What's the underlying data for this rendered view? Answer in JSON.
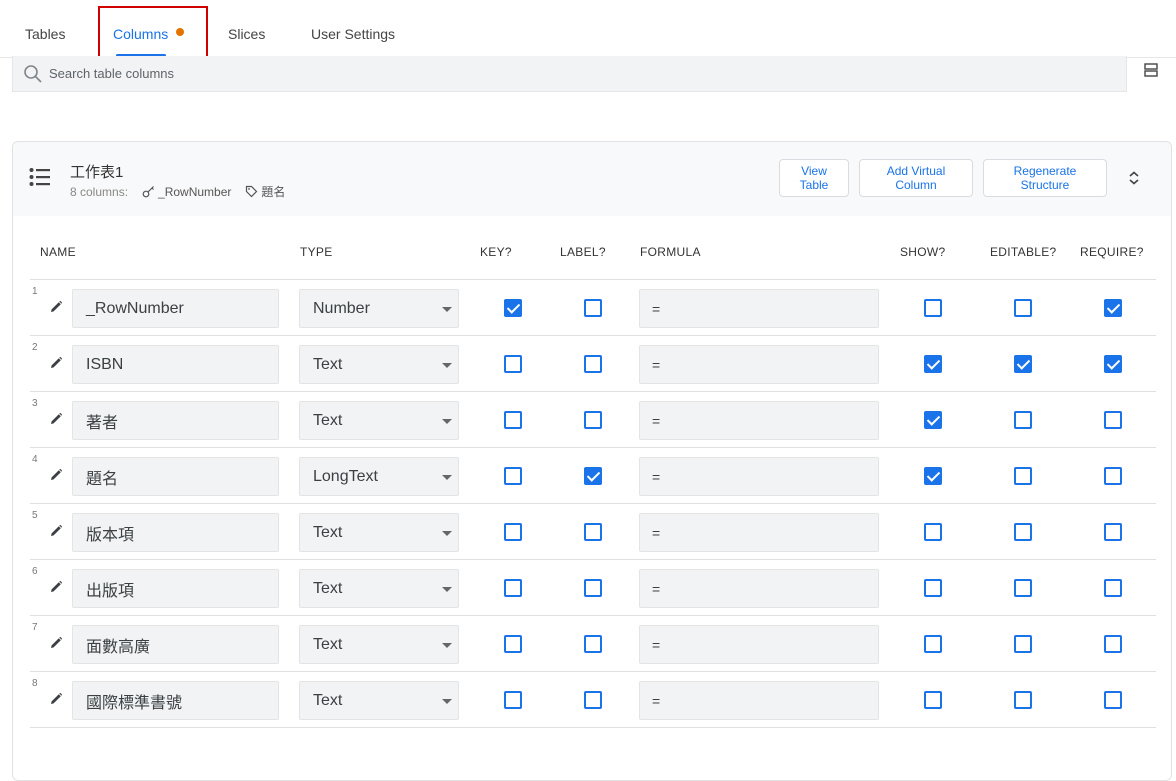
{
  "tabs": [
    {
      "label": "Tables"
    },
    {
      "label": "Columns"
    },
    {
      "label": "Slices"
    },
    {
      "label": "User Settings"
    }
  ],
  "search": {
    "placeholder": "Search table columns"
  },
  "table": {
    "title": "工作表1",
    "column_count": "8 columns:",
    "key_column": "_RowNumber",
    "label_column": "題名",
    "buttons": {
      "view_table": "View\nTable",
      "add_virtual_column": "Add Virtual\nColumn",
      "regenerate_structure": "Regenerate\nStructure"
    }
  },
  "headers": {
    "name": "NAME",
    "type": "TYPE",
    "key": "KEY?",
    "label": "LABEL?",
    "formula": "FORMULA",
    "show": "SHOW?",
    "editable": "EDITABLE?",
    "require": "REQUIRE?"
  },
  "rows": [
    {
      "num": "1",
      "name": "_RowNumber",
      "type": "Number",
      "key": true,
      "label": false,
      "formula": "=",
      "show": false,
      "editable": false,
      "require": true
    },
    {
      "num": "2",
      "name": "ISBN",
      "type": "Text",
      "key": false,
      "label": false,
      "formula": "=",
      "show": true,
      "editable": true,
      "require": true
    },
    {
      "num": "3",
      "name": "著者",
      "type": "Text",
      "key": false,
      "label": false,
      "formula": "=",
      "show": true,
      "editable": false,
      "require": false
    },
    {
      "num": "4",
      "name": "題名",
      "type": "LongText",
      "key": false,
      "label": true,
      "formula": "=",
      "show": true,
      "editable": false,
      "require": false
    },
    {
      "num": "5",
      "name": "版本項",
      "type": "Text",
      "key": false,
      "label": false,
      "formula": "=",
      "show": false,
      "editable": false,
      "require": false
    },
    {
      "num": "6",
      "name": "出版項",
      "type": "Text",
      "key": false,
      "label": false,
      "formula": "=",
      "show": false,
      "editable": false,
      "require": false
    },
    {
      "num": "7",
      "name": "面數高廣",
      "type": "Text",
      "key": false,
      "label": false,
      "formula": "=",
      "show": false,
      "editable": false,
      "require": false
    },
    {
      "num": "8",
      "name": "國際標準書號",
      "type": "Text",
      "key": false,
      "label": false,
      "formula": "=",
      "show": false,
      "editable": false,
      "require": false
    }
  ],
  "colors": {
    "accent": "#1a73e8",
    "unsaved_dot": "#e37400",
    "highlight": "#d00000"
  }
}
